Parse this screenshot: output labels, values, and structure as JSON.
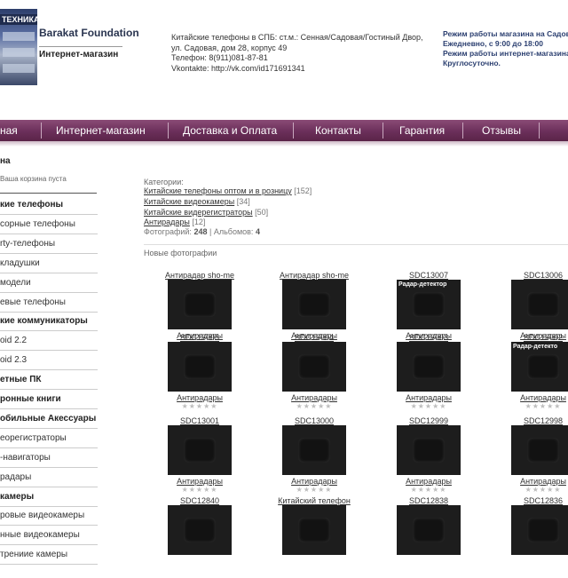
{
  "header": {
    "logo_band": "ТЕХНИКА",
    "brand": "Barakat Foundation",
    "brand_sub": "Интернет-магазин",
    "contact": [
      "Китайские телефоны в СПБ: ст.м.: Сенная/Садовая/Гостиный Двор,",
      "ул. Садовая, дом 28, корпус 49",
      "Телефон: 8(911)081-87-81",
      "Vkontakte: http://vk.com/id171691341"
    ],
    "hours": [
      "Режим работы магазина на Садовой:",
      "Ежедневно, с 9:00 до 18:00",
      "Режим работы интернет-магазина:",
      "Круглосуточно."
    ]
  },
  "nav": [
    "ная",
    "Интернет-магазин",
    "Доставка и Оплата",
    "Контакты",
    "Гарантия",
    "Отзывы"
  ],
  "sidebar": {
    "title": "на",
    "cart_empty": "Ваша корзина пуста",
    "items": [
      {
        "label": "кие телефоны",
        "bold": true
      },
      {
        "label": "сорные телефоны",
        "bold": false
      },
      {
        "label": "rty-телефоны",
        "bold": false
      },
      {
        "label": "кладушки",
        "bold": false
      },
      {
        "label": "модели",
        "bold": false
      },
      {
        "label": "евые телефоны",
        "bold": false
      },
      {
        "label": "кие коммуникаторы",
        "bold": true
      },
      {
        "label": "oid 2.2",
        "bold": false
      },
      {
        "label": "oid 2.3",
        "bold": false
      },
      {
        "label": "етные ПК",
        "bold": true
      },
      {
        "label": "ронные книги",
        "bold": true
      },
      {
        "label": "обильные Акессуары",
        "bold": true
      },
      {
        "label": "еорегистраторы",
        "bold": false
      },
      {
        "label": "-навигаторы",
        "bold": false
      },
      {
        "label": "радары",
        "bold": false
      },
      {
        "label": "камеры",
        "bold": true
      },
      {
        "label": "ровые видеокамеры",
        "bold": false
      },
      {
        "label": "нные видеокамеры",
        "bold": false
      },
      {
        "label": "трениие камеры",
        "bold": false
      }
    ]
  },
  "main": {
    "categories_label": "Категории:",
    "categories": [
      {
        "name": "Китайские телефоны оптом и в розницу",
        "count": "[152]"
      },
      {
        "name": "Китайские видеокамеры",
        "count": "[34]"
      },
      {
        "name": "Китайские видерегистраторы",
        "count": "[50]"
      },
      {
        "name": "Антирадары",
        "count": "[12]"
      }
    ],
    "stats": {
      "photos_label": "Фотографий:",
      "photos": "248",
      "sep": "|",
      "albums_label": "Альбомов:",
      "albums": "4"
    },
    "new_photos_label": "Новые фотографии",
    "stars": "★★★★★",
    "photos": [
      {
        "title": "Антирадар sho-me",
        "category": "Антирадары",
        "thumb": "a"
      },
      {
        "title": "Антирадар sho-me",
        "category": "Антирадары",
        "thumb": "b"
      },
      {
        "title": "SDC13007",
        "category": "Антирадары",
        "thumb": "c"
      },
      {
        "title": "SDC13006",
        "category": "Антирадары",
        "thumb": "d"
      },
      {
        "title": "SDC13005",
        "category": "Антирадары",
        "thumb": "e"
      },
      {
        "title": "SDC13004",
        "category": "Антирадары",
        "thumb": "f"
      },
      {
        "title": "SDC13003",
        "category": "Антирадары",
        "thumb": "g"
      },
      {
        "title": "SDC13002",
        "category": "Антирадары",
        "thumb": "h"
      },
      {
        "title": "SDC13001",
        "category": "Антирадары",
        "thumb": "i"
      },
      {
        "title": "SDC13000",
        "category": "Антирадары",
        "thumb": "j"
      },
      {
        "title": "SDC12999",
        "category": "Антирадары",
        "thumb": "k"
      },
      {
        "title": "SDC12998",
        "category": "Антирадары",
        "thumb": "l"
      },
      {
        "title": "SDC12840",
        "category": "",
        "thumb": "m"
      },
      {
        "title": "Китайский телефон",
        "category": "",
        "thumb": "n"
      },
      {
        "title": "SDC12838",
        "category": "",
        "thumb": "o"
      },
      {
        "title": "SDC12836",
        "category": "",
        "thumb": "p"
      }
    ],
    "thumb_caption_c": "Радар-детектор",
    "thumb_caption_h": "Радар-детекто"
  }
}
